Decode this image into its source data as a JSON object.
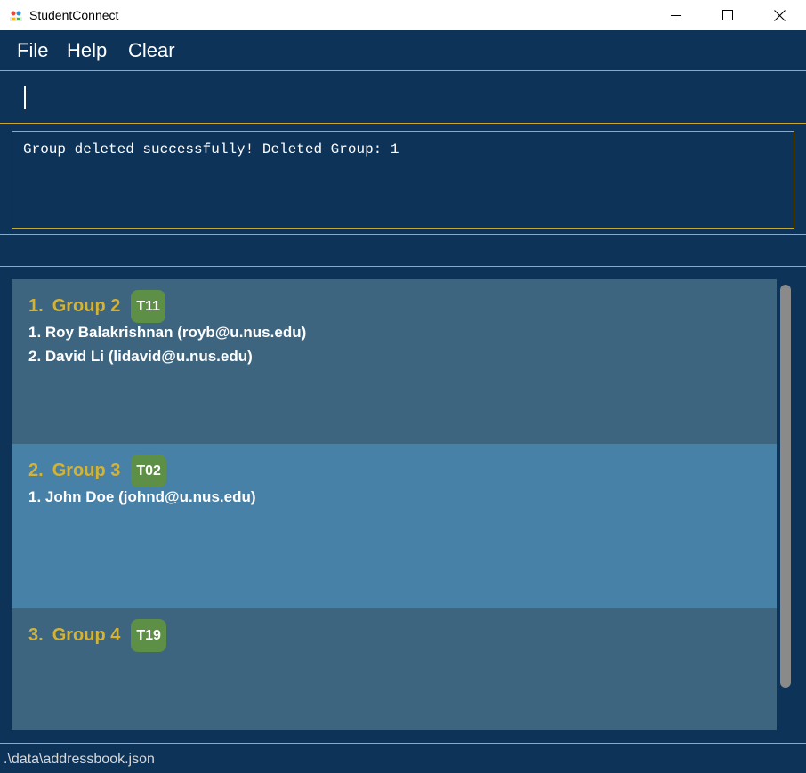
{
  "window": {
    "title": "StudentConnect",
    "minimize_glyph": "—",
    "icons": [
      "app-logo-icon",
      "minimize-icon",
      "maximize-icon",
      "close-icon"
    ]
  },
  "menu": {
    "items": [
      {
        "label": "File"
      },
      {
        "label": "Help"
      },
      {
        "label": "Clear"
      }
    ]
  },
  "command": {
    "value": "",
    "placeholder": ""
  },
  "result": {
    "message": "Group deleted successfully! Deleted Group: 1"
  },
  "groups": [
    {
      "index": "1.",
      "name": "Group 2",
      "tag": "T11",
      "members": [
        "1. Roy Balakrishnan (royb@u.nus.edu)",
        "2. David Li (lidavid@u.nus.edu)"
      ]
    },
    {
      "index": "2.",
      "name": "Group 3",
      "tag": "T02",
      "members": [
        "1. John Doe (johnd@u.nus.edu)"
      ]
    },
    {
      "index": "3.",
      "name": "Group 4",
      "tag": "T19",
      "members": []
    }
  ],
  "status": {
    "path": ".\\data\\addressbook.json"
  },
  "colors": {
    "background": "#0d3359",
    "border_gold": "#c9a82a",
    "group_title": "#d4b233",
    "card_dark": "#3d6580",
    "card_light": "#4781a8",
    "tag": "#5d8f46"
  }
}
